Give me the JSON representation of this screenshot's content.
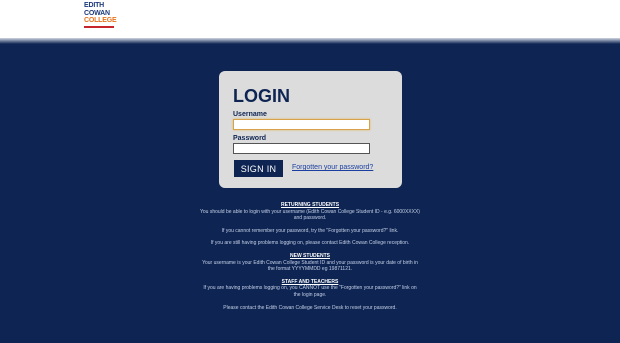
{
  "logo": {
    "line1": "EDITH",
    "line2": "COWAN",
    "line3": "COLLEGE"
  },
  "login": {
    "title": "LOGIN",
    "username_label": "Username",
    "username_value": "",
    "password_label": "Password",
    "password_value": "",
    "signin_label": "SIGN IN",
    "forgot_label": "Forgotten your password?"
  },
  "info": {
    "returning_heading": "RETURNING STUDENTS",
    "returning_p1": "You should be able to login with your username (Edith Cowan College Student ID - e.g. 6000XXXX) and password.",
    "returning_p2": "If you cannot remember your password, try the \"Forgotten your password?\" link.",
    "returning_p3": "If you are still having problems logging on, please contact Edith Cowan College reception.",
    "new_heading": "NEW STUDENTS",
    "new_p1": "Your username is your Edith Cowan College Student ID and your password is your date of birth in the format YYYYMMDD eg 19871121.",
    "staff_heading": "STAFF AND TEACHERS",
    "staff_p1": "If you are having problems logging on, you CANNOT use the \"Forgotten your password?\" link on the login page.",
    "staff_p2": "Please contact the Edith Cowan College Service Desk to reset your password."
  }
}
